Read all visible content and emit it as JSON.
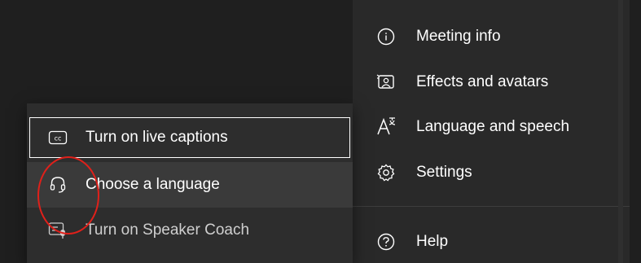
{
  "main_menu": {
    "items": [
      {
        "label": "Meeting info",
        "icon": "info-icon"
      },
      {
        "label": "Effects and avatars",
        "icon": "effects-icon"
      },
      {
        "label": "Language and speech",
        "icon": "language-speech-icon"
      },
      {
        "label": "Settings",
        "icon": "gear-icon"
      },
      {
        "label": "Help",
        "icon": "help-icon"
      }
    ]
  },
  "submenu": {
    "items": [
      {
        "label": "Turn on live captions",
        "icon": "closed-captions-icon",
        "state": "focused"
      },
      {
        "label": "Choose a language",
        "icon": "headset-icon",
        "state": "hovered"
      },
      {
        "label": "Turn on Speaker Coach",
        "icon": "speaker-coach-icon",
        "state": "normal"
      }
    ]
  },
  "colors": {
    "menu_bg": "#292929",
    "submenu_bg": "#2d2d2d",
    "hover_bg": "#3a3a3a",
    "annotation": "#e0201a"
  }
}
